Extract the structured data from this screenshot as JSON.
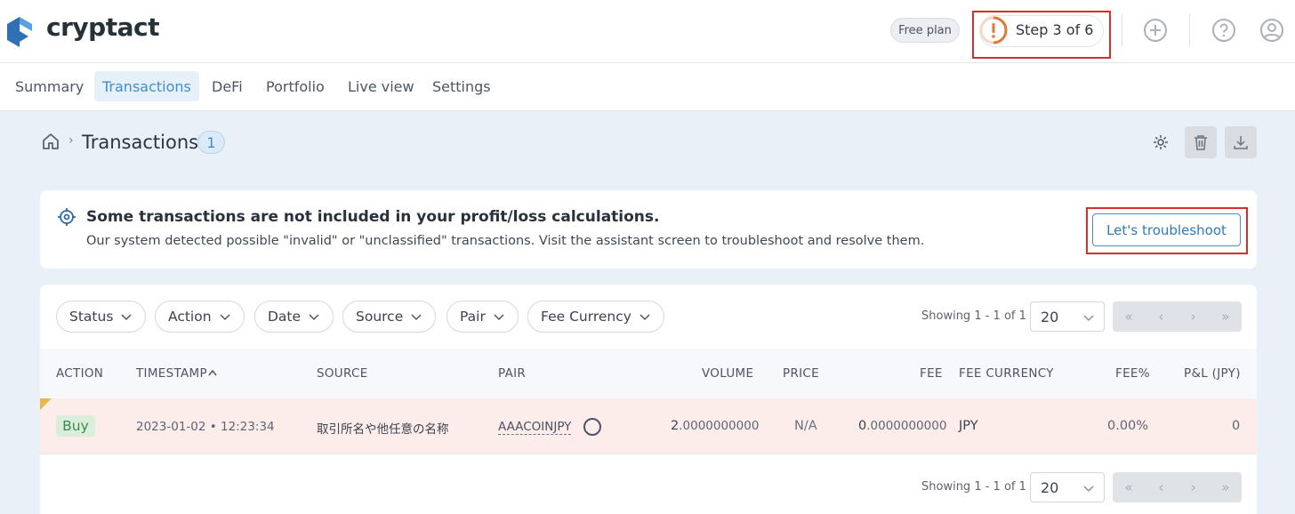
{
  "header": {
    "brand": "cryptact",
    "plan": "Free plan",
    "step": "Step 3 of 6",
    "icons": [
      "add-icon",
      "help-icon",
      "user-icon"
    ]
  },
  "nav": {
    "items": [
      "Summary",
      "Transactions",
      "DeFi",
      "Portfolio",
      "Live view",
      "Settings"
    ],
    "active": "Transactions"
  },
  "page": {
    "title": "Transactions",
    "count": "1",
    "separator": "›"
  },
  "alert": {
    "title": "Some transactions are not included in your profit/loss calculations.",
    "body": "Our system detected possible \"invalid\" or \"unclassified\" transactions. Visit the assistant screen to troubleshoot and resolve them.",
    "button": "Let's troubleshoot"
  },
  "filters": [
    "Status",
    "Action",
    "Date",
    "Source",
    "Pair",
    "Fee Currency"
  ],
  "pagination": {
    "showing": "Showing 1 - 1 of 1",
    "per_page": "20"
  },
  "table": {
    "columns": [
      "ACTION",
      "TIMESTAMP",
      "SOURCE",
      "PAIR",
      "VOLUME",
      "PRICE",
      "FEE",
      "FEE CURRENCY",
      "FEE%",
      "P&L (JPY)"
    ],
    "rows": [
      {
        "action": "Buy",
        "timestamp": "2023-01-02 • 12:23:34",
        "source": "取引所名や他任意の名称",
        "pair": "AAACOINJPY",
        "volume_int": "2",
        "volume_dec": ".0000000000",
        "price": "N/A",
        "fee_int": "0",
        "fee_dec": ".0000000000",
        "fee_currency": "JPY",
        "fee_pct": "0.00%",
        "pnl": "0"
      }
    ]
  },
  "colors": {
    "accent": "#3d8fd0",
    "highlight": "#d32f2f",
    "error_row": "#fcecea",
    "buy": "#3c8b47"
  }
}
